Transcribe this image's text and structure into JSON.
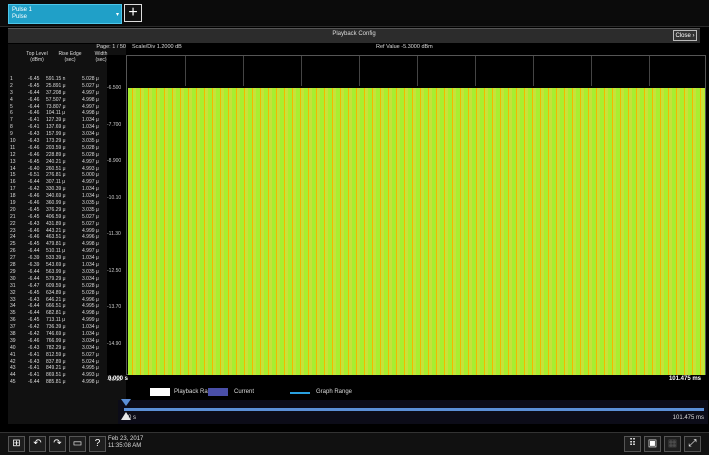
{
  "tab": {
    "line1": "Pulse 1",
    "line2": "Pulse",
    "caret": "▾"
  },
  "titlebar": {
    "title": "Playback Config",
    "close_label": "Close"
  },
  "table": {
    "page_label": "Page: 1 / 50",
    "headers": [
      "Top Level (dBm)",
      "Rise Edge (sec)",
      "Width (sec)"
    ],
    "rows": [
      [
        "1",
        "-6.45",
        "591.15 n",
        "5.028 μ"
      ],
      [
        "2",
        "-6.45",
        "25.891 μ",
        "5.027 μ"
      ],
      [
        "3",
        "-6.44",
        "37.208 μ",
        "4.997 μ"
      ],
      [
        "4",
        "-6.46",
        "57.507 μ",
        "4.998 μ"
      ],
      [
        "5",
        "-6.44",
        "73.807 μ",
        "4.997 μ"
      ],
      [
        "6",
        "-6.46",
        "104.11 μ",
        "4.998 μ"
      ],
      [
        "7",
        "-6.41",
        "127.39 μ",
        "1.034 μ"
      ],
      [
        "8",
        "-6.41",
        "137.69 μ",
        "1.034 μ"
      ],
      [
        "9",
        "-6.43",
        "157.99 μ",
        "3.034 μ"
      ],
      [
        "10",
        "-6.43",
        "173.29 μ",
        "3.035 μ"
      ],
      [
        "11",
        "-6.46",
        "203.59 μ",
        "5.028 μ"
      ],
      [
        "12",
        "-6.46",
        "228.89 μ",
        "5.028 μ"
      ],
      [
        "13",
        "-6.45",
        "240.21 μ",
        "4.997 μ"
      ],
      [
        "14",
        "-6.40",
        "260.51 μ",
        "4.993 μ"
      ],
      [
        "15",
        "-6.51",
        "276.81 μ",
        "5.000 μ"
      ],
      [
        "16",
        "-6.44",
        "307.11 μ",
        "4.997 μ"
      ],
      [
        "17",
        "-6.42",
        "330.39 μ",
        "1.034 μ"
      ],
      [
        "18",
        "-6.46",
        "340.69 μ",
        "1.034 μ"
      ],
      [
        "19",
        "-6.46",
        "360.99 μ",
        "3.035 μ"
      ],
      [
        "20",
        "-6.45",
        "376.29 μ",
        "3.035 μ"
      ],
      [
        "21",
        "-6.45",
        "406.59 μ",
        "5.027 μ"
      ],
      [
        "22",
        "-6.43",
        "431.89 μ",
        "5.027 μ"
      ],
      [
        "23",
        "-6.46",
        "443.21 μ",
        "4.999 μ"
      ],
      [
        "24",
        "-6.46",
        "463.51 μ",
        "4.996 μ"
      ],
      [
        "25",
        "-6.45",
        "479.81 μ",
        "4.998 μ"
      ],
      [
        "26",
        "-6.44",
        "510.11 μ",
        "4.997 μ"
      ],
      [
        "27",
        "-6.39",
        "533.39 μ",
        "1.034 μ"
      ],
      [
        "28",
        "-6.39",
        "543.69 μ",
        "1.034 μ"
      ],
      [
        "29",
        "-6.44",
        "563.99 μ",
        "3.035 μ"
      ],
      [
        "30",
        "-6.44",
        "579.29 μ",
        "3.034 μ"
      ],
      [
        "31",
        "-6.47",
        "609.59 μ",
        "5.028 μ"
      ],
      [
        "32",
        "-6.45",
        "634.89 μ",
        "5.028 μ"
      ],
      [
        "33",
        "-6.43",
        "646.21 μ",
        "4.996 μ"
      ],
      [
        "34",
        "-6.44",
        "666.51 μ",
        "4.995 μ"
      ],
      [
        "35",
        "-6.44",
        "682.81 μ",
        "4.998 μ"
      ],
      [
        "36",
        "-6.45",
        "713.11 μ",
        "4.999 μ"
      ],
      [
        "37",
        "-6.42",
        "736.39 μ",
        "1.034 μ"
      ],
      [
        "38",
        "-6.42",
        "746.69 μ",
        "1.034 μ"
      ],
      [
        "39",
        "-6.46",
        "766.99 μ",
        "3.034 μ"
      ],
      [
        "40",
        "-6.43",
        "782.29 μ",
        "3.034 μ"
      ],
      [
        "41",
        "-6.41",
        "812.59 μ",
        "5.027 μ"
      ],
      [
        "42",
        "-6.43",
        "837.89 μ",
        "5.024 μ"
      ],
      [
        "43",
        "-6.41",
        "849.21 μ",
        "4.995 μ"
      ],
      [
        "44",
        "-6.41",
        "869.51 μ",
        "4.993 μ"
      ],
      [
        "45",
        "-6.44",
        "885.81 μ",
        "4.998 μ"
      ]
    ]
  },
  "plot": {
    "scale_label": "Scale/Div 1.2000 dB",
    "ref_label": "Ref Value -5.3000 dBm",
    "y_ticks": [
      "-6.500",
      "-7.700",
      "-8.900",
      "-10.10",
      "-11.30",
      "-12.50",
      "-13.70",
      "-14.90",
      "-16.10"
    ],
    "x_start": "0.000 s",
    "x_end": "101.475 ms",
    "colors": {
      "trace": "#a8ee30",
      "trace_alt": "#f2b800"
    }
  },
  "legend": {
    "playback_range": "Playback Range",
    "current": "Current",
    "graph_range": "Graph Range",
    "colors": {
      "playback": "#ffffff",
      "current": "#4a4fa8",
      "graph": "#29a0e0"
    }
  },
  "scroller": {
    "start": "0 s",
    "end": "101.475 ms"
  },
  "taskbar": {
    "date": "Feb 23, 2017",
    "time": "11:35:08 AM"
  }
}
